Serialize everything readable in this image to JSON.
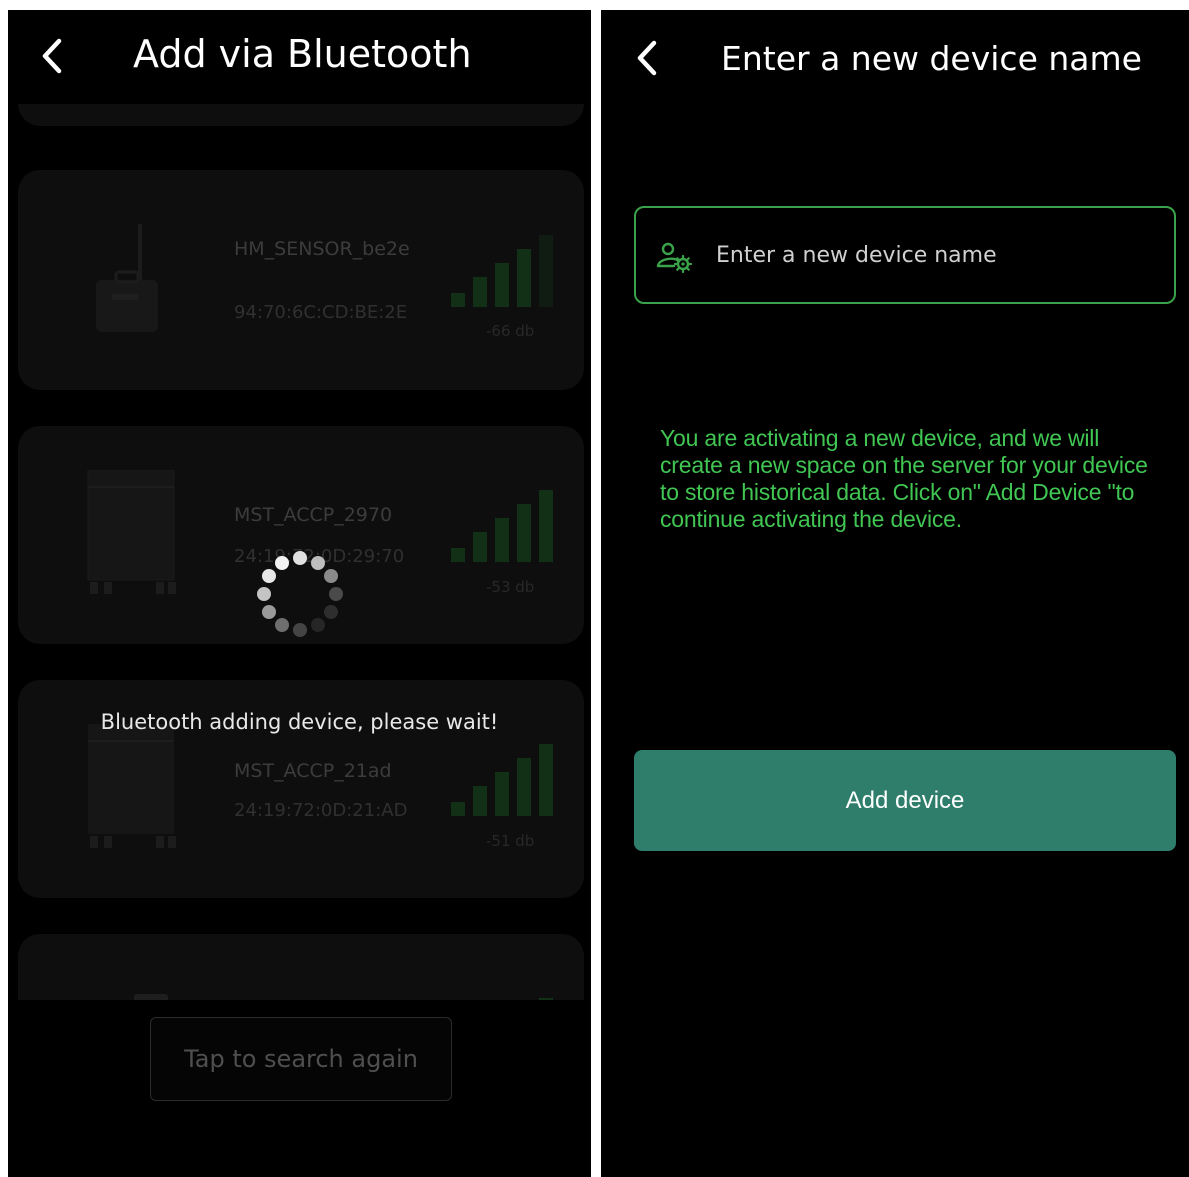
{
  "left_screen": {
    "title": "Add via Bluetooth",
    "devices": [
      {
        "name": "HM_SENSOR_be2e",
        "mac": "94:70:6C:CD:BE:2E",
        "signal": "-66 db",
        "signal_bars_active": 4
      },
      {
        "name": "MST_ACCP_2970",
        "mac": "24:19:72:0D:29:70",
        "signal": "-53 db",
        "signal_bars_active": 5
      },
      {
        "name": "MST_ACCP_21ad",
        "mac": "24:19:72:0D:21:AD",
        "signal": "-51 db",
        "signal_bars_active": 5
      }
    ],
    "loading_message": "Bluetooth adding device, please wait!",
    "search_again_label": "Tap to search again"
  },
  "right_screen": {
    "title": "Enter a new device name",
    "device_name_field": {
      "placeholder": "Enter a new device name",
      "value": ""
    },
    "info_text": "You are activating a new device, and we will create a new space on the server for your device to store historical data. Click on\" Add Device \"to continue activating the device.",
    "add_button_label": "Add device"
  },
  "colors": {
    "accent_green": "#41c653",
    "input_border": "#3aa24a",
    "button_teal": "#2f7e6b",
    "background": "#000000"
  },
  "icons": [
    "back-chevron-icon",
    "user-settings-icon",
    "loading-spinner-icon",
    "signal-strength-icon"
  ]
}
